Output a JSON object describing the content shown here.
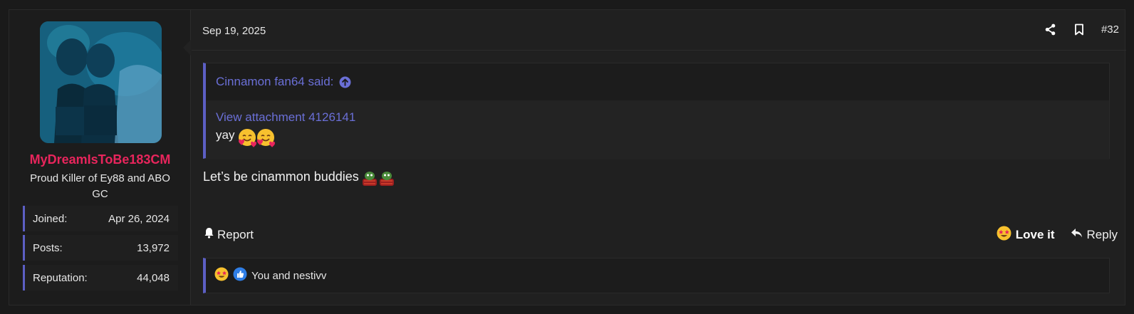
{
  "user": {
    "username": "MyDreamIsToBe183CM",
    "title": "Proud Killer of Ey88 and ABO GC",
    "stats": [
      {
        "label": "Joined:",
        "value": "Apr 26, 2024"
      },
      {
        "label": "Posts:",
        "value": "13,972"
      },
      {
        "label": "Reputation:",
        "value": "44,048"
      }
    ]
  },
  "post": {
    "date": "Sep 19, 2025",
    "number": "#32",
    "quote": {
      "author": "Cinnamon fan64 said:",
      "attachment": "View attachment 4126141",
      "text": "yay"
    },
    "message": "Let’s be cinammon buddies",
    "report_label": "Report",
    "love_label": "Love it",
    "reply_label": "Reply",
    "reactions_text": "You and nestivv"
  },
  "colors": {
    "accent": "#5c5fc4",
    "username": "#e8255c",
    "link": "#6a6fd6"
  }
}
